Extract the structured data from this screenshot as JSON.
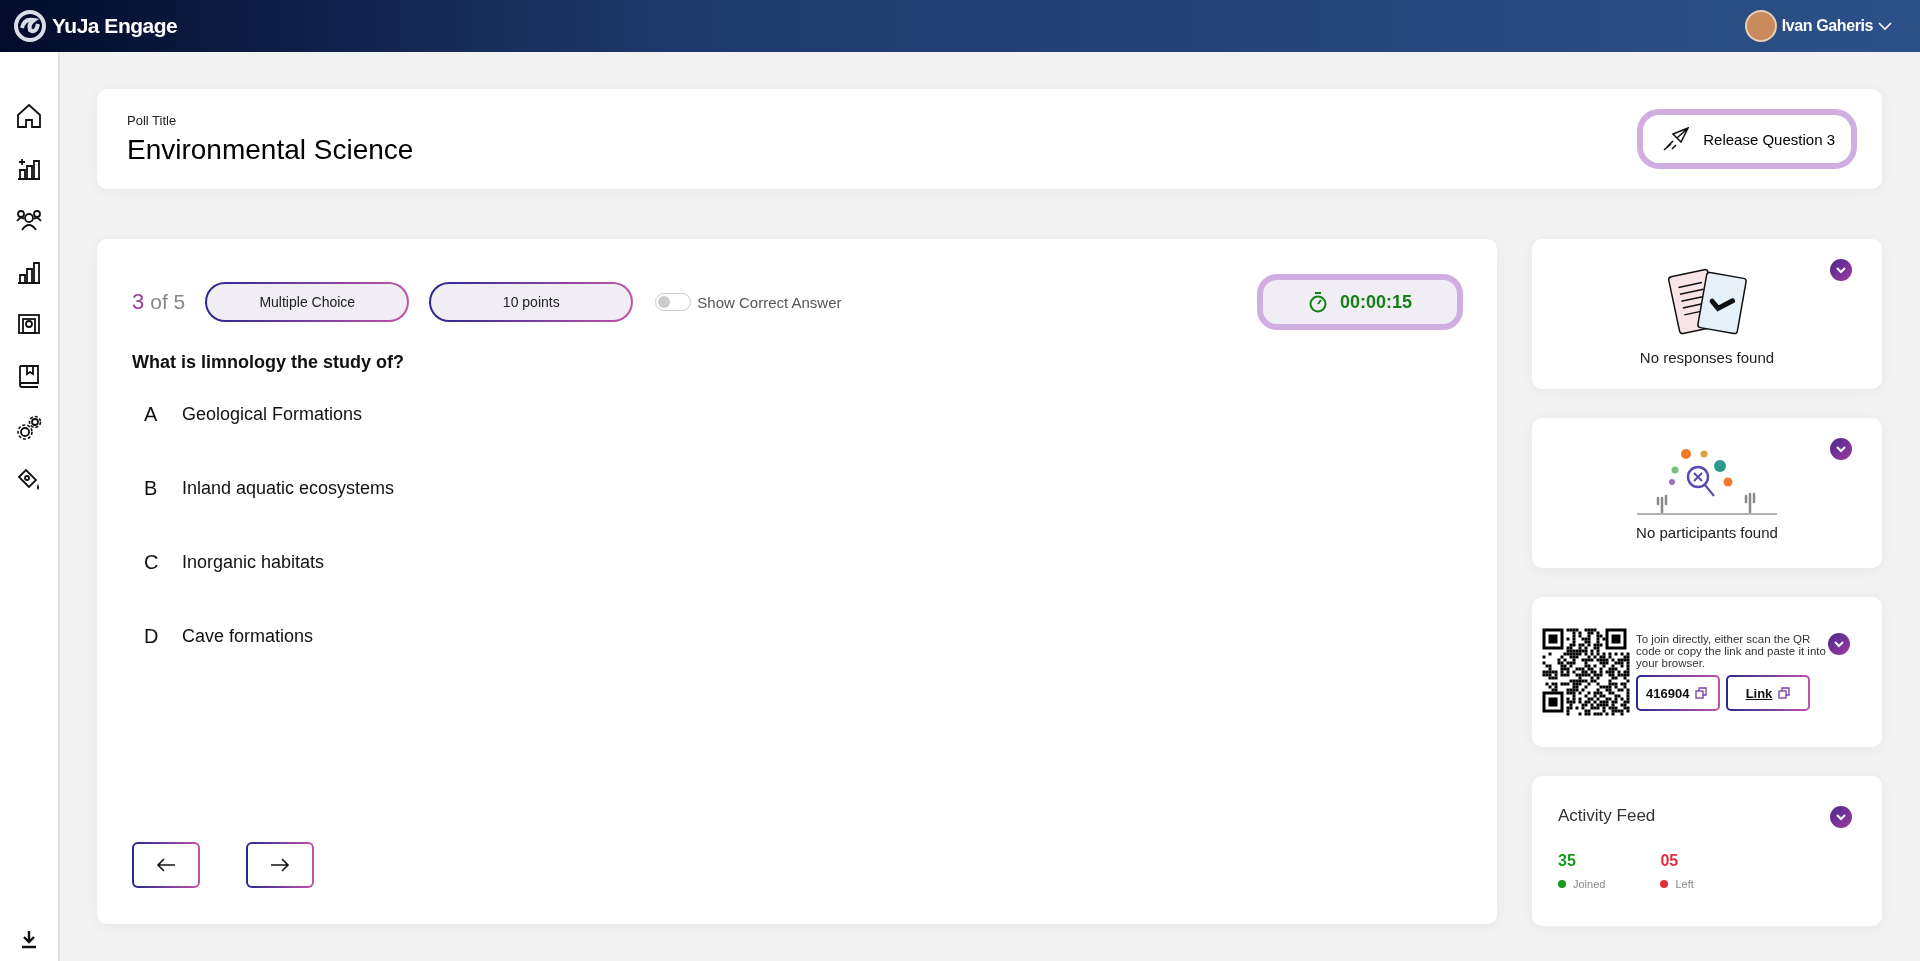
{
  "header": {
    "app_name": "YuJa Engage",
    "user_name": "Ivan Gaheris"
  },
  "poll": {
    "title_label": "Poll Title",
    "title": "Environmental Science",
    "release_button": "Release Question 3"
  },
  "question": {
    "current": "3",
    "total": "of 5",
    "type": "Multiple Choice",
    "points": "10 points",
    "show_correct_answer": {
      "label": "Show Correct Answer",
      "on": false
    },
    "timer": "00:00:15",
    "text": "What is limnology the study of?",
    "options": [
      {
        "letter": "A",
        "text": "Geological Formations"
      },
      {
        "letter": "B",
        "text": "Inland aquatic ecosystems"
      },
      {
        "letter": "C",
        "text": "Inorganic habitats"
      },
      {
        "letter": "D",
        "text": "Cave formations"
      }
    ]
  },
  "responses": {
    "message": "No responses found"
  },
  "participants": {
    "message": "No participants found"
  },
  "join": {
    "instructions": "To join directly, either scan the QR code or copy the link and paste it into your browser.",
    "code": "416904",
    "link": "Link"
  },
  "activity": {
    "title": "Activity Feed",
    "stats": [
      {
        "value": "35",
        "label": "Joined",
        "color": "#1a9a1a"
      },
      {
        "value": "05",
        "label": "Left",
        "color": "#e0303a"
      }
    ]
  }
}
